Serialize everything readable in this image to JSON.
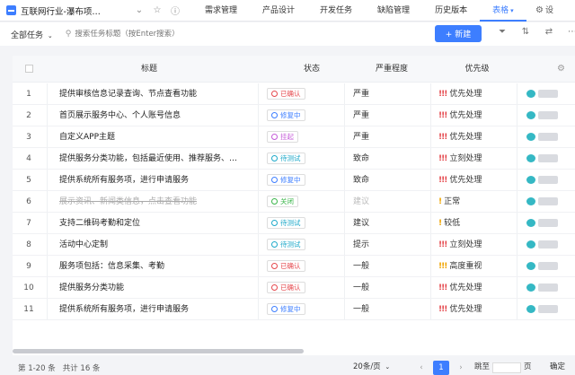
{
  "topbar": {
    "project_title": "互联网行业-瀑布项…",
    "nav_tabs": [
      {
        "label": "需求管理"
      },
      {
        "label": "产品设计"
      },
      {
        "label": "开发任务"
      },
      {
        "label": "缺陷管理"
      },
      {
        "label": "历史版本"
      },
      {
        "label": "表格",
        "active": true
      }
    ],
    "settings_label": "设"
  },
  "toolbar": {
    "filter_label": "全部任务",
    "search_placeholder": "搜索任务标题（按Enter搜索）",
    "new_button": "+ 新建"
  },
  "table": {
    "columns": [
      "标题",
      "状态",
      "严重程度",
      "优先级"
    ],
    "rows": [
      {
        "num": "1",
        "title": "提供审核信息记录查询、节点查看功能",
        "status": "已确认",
        "status_color": "#e5484d",
        "severity": "严重",
        "priority_mark": "!!!",
        "priority": "优先处理",
        "priority_color": "#e5484d"
      },
      {
        "num": "2",
        "title": "首页展示服务中心、个人账号信息",
        "status": "修复中",
        "status_color": "#3d7eff",
        "severity": "严重",
        "priority_mark": "!!!",
        "priority": "优先处理",
        "priority_color": "#e5484d"
      },
      {
        "num": "3",
        "title": "自定义APP主题",
        "status": "挂起",
        "status_color": "#c45ad8",
        "severity": "严重",
        "priority_mark": "!!!",
        "priority": "优先处理",
        "priority_color": "#e5484d"
      },
      {
        "num": "4",
        "title": "提供服务分类功能，包括最近使用、推荐服务、…",
        "status": "待测试",
        "status_color": "#1fa9c9",
        "severity": "致命",
        "priority_mark": "!!!",
        "priority": "立刻处理",
        "priority_color": "#e5484d"
      },
      {
        "num": "5",
        "title": "提供系统所有服务项，进行申请服务",
        "status": "修复中",
        "status_color": "#3d7eff",
        "severity": "致命",
        "priority_mark": "!!!",
        "priority": "优先处理",
        "priority_color": "#e5484d"
      },
      {
        "num": "6",
        "title": "展示资讯、新闻类信息，点击查看功能",
        "status": "关闭",
        "status_color": "#3bb54a",
        "severity": "建议",
        "priority_mark": "!",
        "priority": "正常",
        "priority_color": "#f0a500",
        "done": true
      },
      {
        "num": "7",
        "title": "支持二维码考勤和定位",
        "status": "待测试",
        "status_color": "#1fa9c9",
        "severity": "建议",
        "priority_mark": "!",
        "priority": "较低",
        "priority_color": "#f0a500"
      },
      {
        "num": "8",
        "title": "活动中心定制",
        "status": "待测试",
        "status_color": "#1fa9c9",
        "severity": "提示",
        "priority_mark": "!!!",
        "priority": "立刻处理",
        "priority_color": "#e5484d"
      },
      {
        "num": "9",
        "title": "服务项包括：信息采集、考勤",
        "status": "已确认",
        "status_color": "#e5484d",
        "severity": "一般",
        "priority_mark": "!!!",
        "priority": "高度重视",
        "priority_color": "#f0a500"
      },
      {
        "num": "10",
        "title": "提供服务分类功能",
        "status": "已确认",
        "status_color": "#e5484d",
        "severity": "一般",
        "priority_mark": "!!!",
        "priority": "优先处理",
        "priority_color": "#e5484d"
      },
      {
        "num": "11",
        "title": "提供系统所有服务项，进行申请服务",
        "status": "修复中",
        "status_color": "#3d7eff",
        "severity": "一般",
        "priority_mark": "!!!",
        "priority": "优先处理",
        "priority_color": "#e5484d"
      }
    ]
  },
  "footer": {
    "range": "第 1-20 条",
    "total": "共计 16 条",
    "page_size": "20条/页",
    "current_page": "1",
    "goto_label": "跳至",
    "page_suffix": "页",
    "confirm": "确定"
  },
  "colors": {
    "accent": "#3d7eff",
    "owner_avatar": "#35b8c4"
  }
}
